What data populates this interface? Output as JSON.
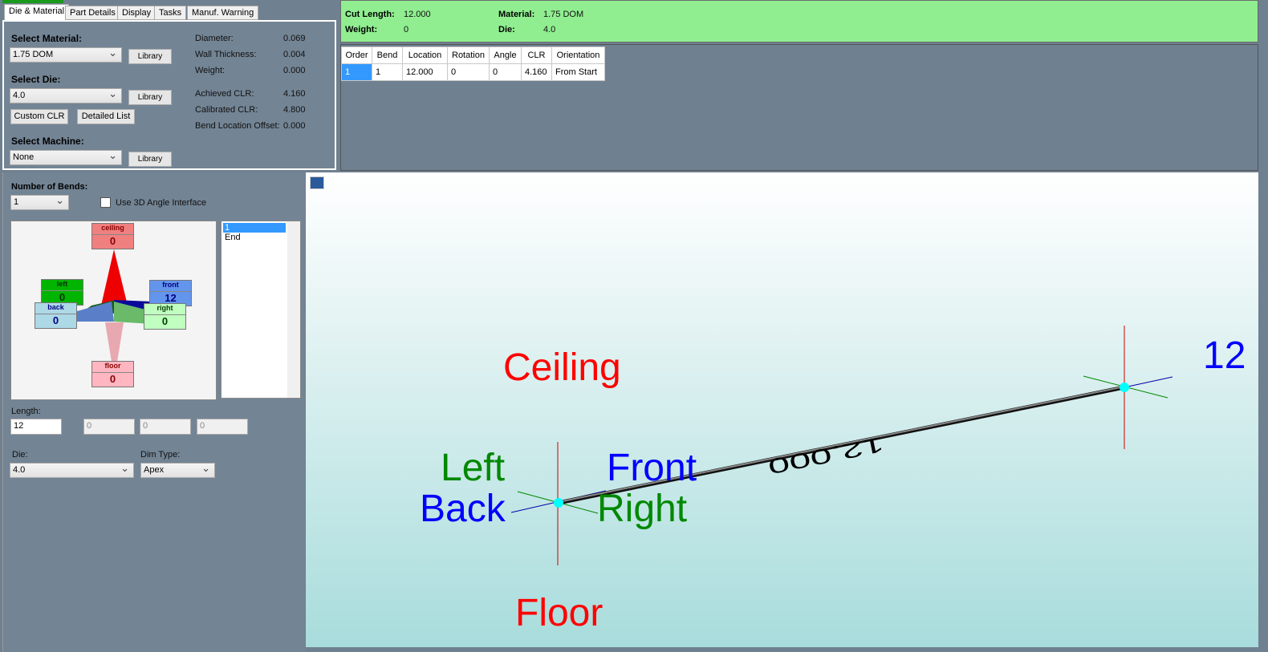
{
  "tabs": [
    "Die & Material",
    "Part Details",
    "Display",
    "Tasks",
    "Manuf. Warning"
  ],
  "die_material": {
    "select_material_label": "Select Material:",
    "material_value": "1.75 DOM",
    "select_die_label": "Select Die:",
    "die_value": "4.0",
    "select_machine_label": "Select Machine:",
    "machine_value": "None",
    "library_label": "Library",
    "custom_clr_label": "Custom CLR",
    "detailed_list_label": "Detailed List",
    "props": [
      {
        "label": "Diameter:",
        "value": "0.069"
      },
      {
        "label": "Wall Thickness:",
        "value": "0.004"
      },
      {
        "label": "Weight:",
        "value": "0.000"
      },
      {
        "label": "Achieved CLR:",
        "value": "4.160"
      },
      {
        "label": "Calibrated CLR:",
        "value": "4.800"
      },
      {
        "label": "Bend Location Offset:",
        "value": "0.000"
      }
    ]
  },
  "summary": {
    "cut_length_label": "Cut Length:",
    "cut_length": "12.000",
    "weight_label": "Weight:",
    "weight": "0",
    "material_label": "Material:",
    "material": "1.75 DOM",
    "die_label": "Die:",
    "die": "4.0"
  },
  "bend_table": {
    "columns": [
      "Order",
      "Bend",
      "Location",
      "Rotation",
      "Angle",
      "CLR",
      "Orientation"
    ],
    "rows": [
      [
        "1",
        "1",
        "12.000",
        "0",
        "0",
        "4.160",
        "From Start"
      ]
    ]
  },
  "bends": {
    "number_label": "Number of Bends:",
    "number_value": "1",
    "use_3d_label": "Use 3D Angle Interface",
    "use_3d_checked": false,
    "compass": {
      "ceiling": {
        "label": "ceiling",
        "value": "0"
      },
      "floor": {
        "label": "floor",
        "value": "0"
      },
      "left": {
        "label": "left",
        "value": "0"
      },
      "back": {
        "label": "back",
        "value": "0"
      },
      "front": {
        "label": "front",
        "value": "12"
      },
      "right": {
        "label": "right",
        "value": "0"
      }
    },
    "list": [
      "1",
      "End"
    ],
    "length_label": "Length:",
    "length_value": "12",
    "extra_values": [
      "0",
      "0",
      "0"
    ],
    "die_label": "Die:",
    "die_value": "4.0",
    "dim_type_label": "Dim Type:",
    "dim_type_value": "Apex"
  },
  "view": {
    "ceiling": "Ceiling",
    "floor": "Floor",
    "left": "Left",
    "back": "Back",
    "front": "Front",
    "right": "Right",
    "end_label": "12",
    "segment_label": "12.000"
  },
  "colors": {
    "summary_bg": "#90ee90",
    "selection": "#3399ff",
    "ceiling": "#ff0000",
    "front": "#0000ff",
    "left": "#008000"
  }
}
